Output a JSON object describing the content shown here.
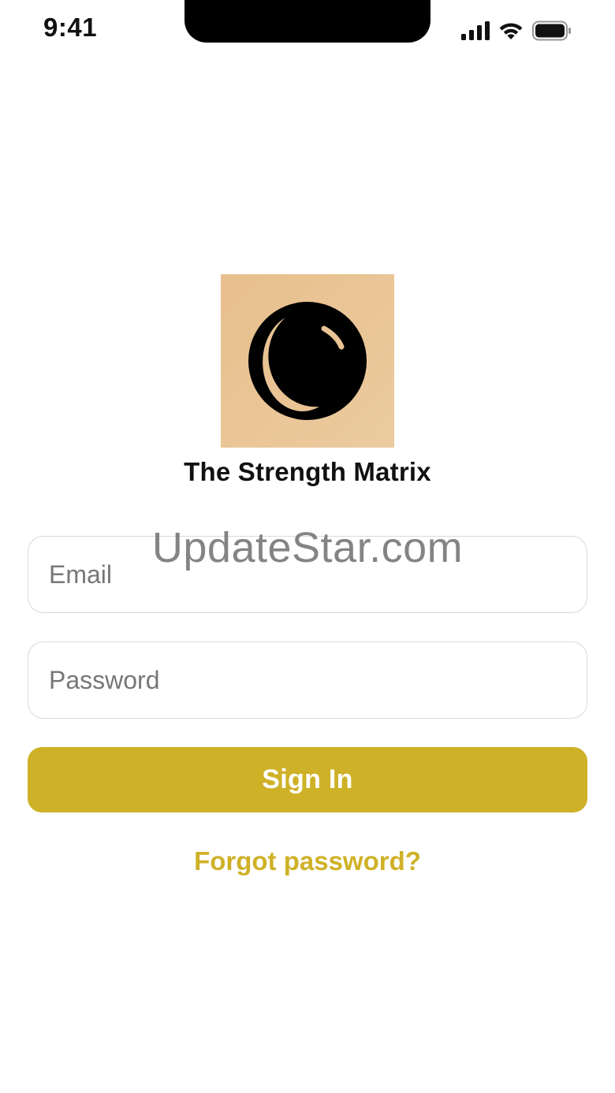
{
  "status_bar": {
    "time": "9:41",
    "icons": [
      "cellular-signal-icon",
      "wifi-icon",
      "battery-icon"
    ]
  },
  "logo": {
    "icon": "moon-sphere-icon",
    "background_color": "#E8BF8D"
  },
  "app": {
    "name": "The Strength Matrix"
  },
  "form": {
    "email": {
      "placeholder": "Email",
      "value": ""
    },
    "password": {
      "placeholder": "Password",
      "value": ""
    },
    "sign_in_label": "Sign In",
    "forgot_password_label": "Forgot password?"
  },
  "watermark": {
    "text": "UpdateStar.com"
  },
  "colors": {
    "accent": "#CFB127",
    "field_border": "#D9D9D9",
    "text": "#111111"
  }
}
